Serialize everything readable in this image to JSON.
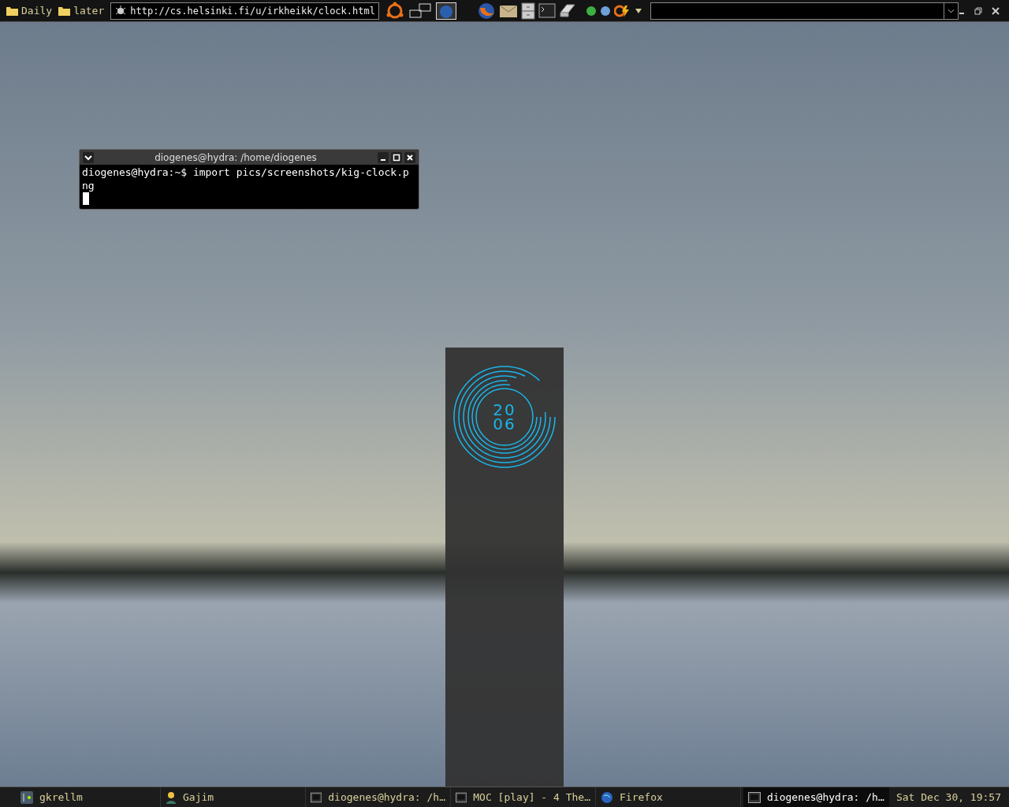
{
  "top_bar": {
    "bookmarks": [
      {
        "label": "Daily"
      },
      {
        "label": "later"
      }
    ],
    "url_field": {
      "value": "http://cs.helsinki.fi/u/irkheikk/clock.html"
    }
  },
  "terminal": {
    "title": "diogenes@hydra: /home/diogenes",
    "lines": [
      "diogenes@hydra:~$ import pics/screenshots/kig-clock.p",
      "ng"
    ]
  },
  "clock_widget": {
    "lines": [
      "20",
      "06"
    ]
  },
  "taskbar": {
    "tasks": [
      {
        "label": "gkrellm",
        "kind": "monitor",
        "selected": false
      },
      {
        "label": "Gajim",
        "kind": "chat",
        "selected": false
      },
      {
        "label": "diogenes@hydra: /h…",
        "kind": "terminal",
        "selected": false
      },
      {
        "label": "MOC [play] - 4 The…",
        "kind": "terminal",
        "selected": false
      },
      {
        "label": "Firefox",
        "kind": "globe",
        "selected": false
      },
      {
        "label": "diogenes@hydra: /h…",
        "kind": "terminal",
        "selected": true
      }
    ],
    "clock": "Sat Dec 30, 19:57"
  }
}
